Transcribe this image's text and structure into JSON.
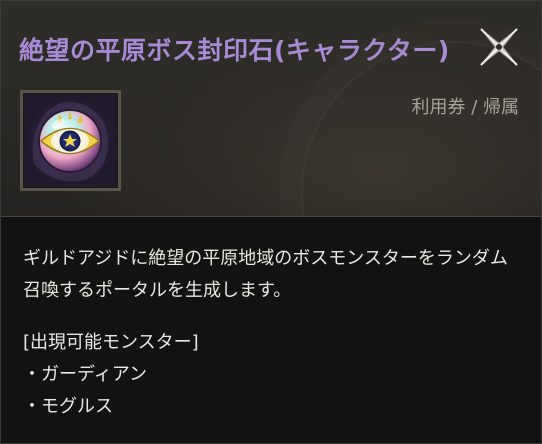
{
  "item": {
    "title": "絶望の平原ボス封印石(キャラクター)",
    "tags": "利用券 / 帰属",
    "icon": "sealed-eye-orb-icon",
    "description": "ギルドアジドに絶望の平原地域のボスモンスターをランダム召喚するポータルを生成します。",
    "monsters_header": "[出現可能モンスター]",
    "monsters": [
      "・ガーディアン",
      "・モグルス"
    ]
  },
  "colors": {
    "title": "#a98ad6",
    "tags": "#a7a39a",
    "text": "#e9e7e2"
  }
}
